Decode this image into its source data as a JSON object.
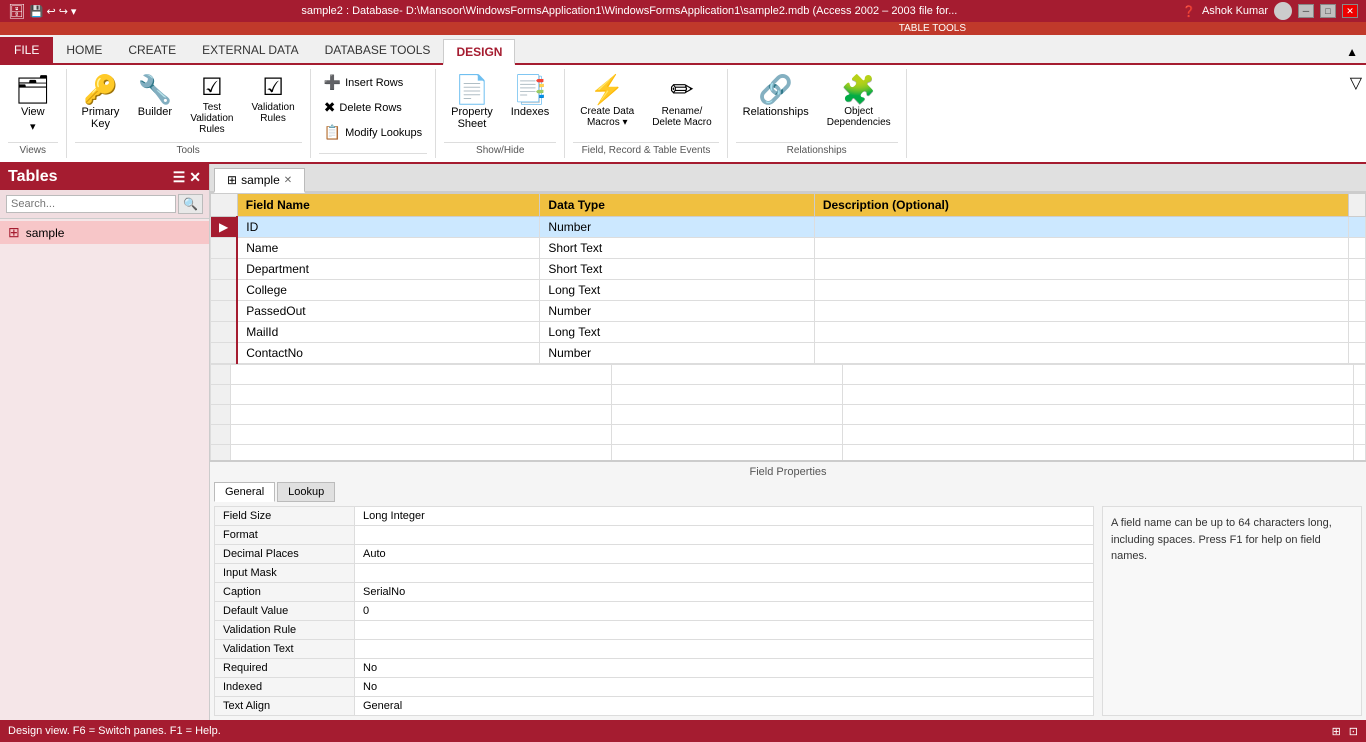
{
  "titlebar": {
    "text": "sample2 : Database- D:\\Mansoor\\WindowsFormsApplication1\\WindowsFormsApplication1\\sample2.mdb (Access 2002 – 2003 file for...",
    "user": "Ashok Kumar"
  },
  "ribbon": {
    "table_tools_label": "TABLE TOOLS",
    "tabs": [
      {
        "id": "file",
        "label": "FILE",
        "type": "file"
      },
      {
        "id": "home",
        "label": "HOME"
      },
      {
        "id": "create",
        "label": "CREATE"
      },
      {
        "id": "external",
        "label": "EXTERNAL DATA"
      },
      {
        "id": "dbtools",
        "label": "DATABASE TOOLS"
      },
      {
        "id": "design",
        "label": "DESIGN",
        "active": true
      }
    ],
    "groups": {
      "views": {
        "label": "Views",
        "buttons": [
          {
            "label": "View",
            "icon": "🗂"
          }
        ]
      },
      "tools": {
        "label": "Tools",
        "buttons": [
          {
            "label": "Primary\nKey",
            "icon": "🔑"
          },
          {
            "label": "Builder",
            "icon": "🔧"
          },
          {
            "label": "Test\nValidation\nRules",
            "icon": "☑"
          },
          {
            "label": "Validation\nRules",
            "icon": "☑"
          }
        ]
      },
      "insertrows": {
        "label": "Insert Rows",
        "items": [
          {
            "label": "Insert Rows",
            "icon": "➕"
          },
          {
            "label": "Delete Rows",
            "icon": "✖"
          },
          {
            "label": "Modify Lookups",
            "icon": "📋"
          }
        ]
      },
      "showHide": {
        "label": "Show/Hide",
        "buttons": [
          {
            "label": "Property\nSheet",
            "icon": "📄"
          },
          {
            "label": "Indexes",
            "icon": "📑"
          }
        ]
      },
      "fieldEvents": {
        "label": "Field, Record & Table Events",
        "buttons": [
          {
            "label": "Create Data\nMacros ▾",
            "icon": "⚡"
          },
          {
            "label": "Rename/\nDelete Macro",
            "icon": "✏"
          }
        ]
      },
      "relationships": {
        "label": "Relationships",
        "buttons": [
          {
            "label": "Relationships",
            "icon": "🔗"
          },
          {
            "label": "Object\nDependencies",
            "icon": "🧩"
          }
        ]
      }
    }
  },
  "leftPanel": {
    "title": "Tables",
    "search": {
      "placeholder": "Search...",
      "value": ""
    },
    "items": [
      {
        "label": "sample"
      }
    ]
  },
  "contentTab": {
    "label": "sample"
  },
  "tableDesign": {
    "columns": [
      "Field Name",
      "Data Type",
      "Description (Optional)"
    ],
    "rows": [
      {
        "name": "ID",
        "type": "Number",
        "description": "",
        "selected": true
      },
      {
        "name": "Name",
        "type": "Short Text",
        "description": ""
      },
      {
        "name": "Department",
        "type": "Short Text",
        "description": ""
      },
      {
        "name": "College",
        "type": "Long Text",
        "description": ""
      },
      {
        "name": "PassedOut",
        "type": "Number",
        "description": ""
      },
      {
        "name": "MailId",
        "type": "Long Text",
        "description": ""
      },
      {
        "name": "ContactNo",
        "type": "Number",
        "description": ""
      }
    ]
  },
  "fieldProperties": {
    "title": "Field Properties",
    "tabs": [
      "General",
      "Lookup"
    ],
    "activeTab": "General",
    "properties": [
      {
        "label": "Field Size",
        "value": "Long Integer"
      },
      {
        "label": "Format",
        "value": ""
      },
      {
        "label": "Decimal Places",
        "value": "Auto"
      },
      {
        "label": "Input Mask",
        "value": ""
      },
      {
        "label": "Caption",
        "value": "SerialNo"
      },
      {
        "label": "Default Value",
        "value": "0"
      },
      {
        "label": "Validation Rule",
        "value": ""
      },
      {
        "label": "Validation Text",
        "value": ""
      },
      {
        "label": "Required",
        "value": "No"
      },
      {
        "label": "Indexed",
        "value": "No"
      },
      {
        "label": "Text Align",
        "value": "General"
      }
    ],
    "hint": "A field name can be up to 64 characters long, including spaces. Press F1 for help on field names."
  },
  "statusBar": {
    "text": "Design view.  F6 = Switch panes.  F1 = Help."
  }
}
